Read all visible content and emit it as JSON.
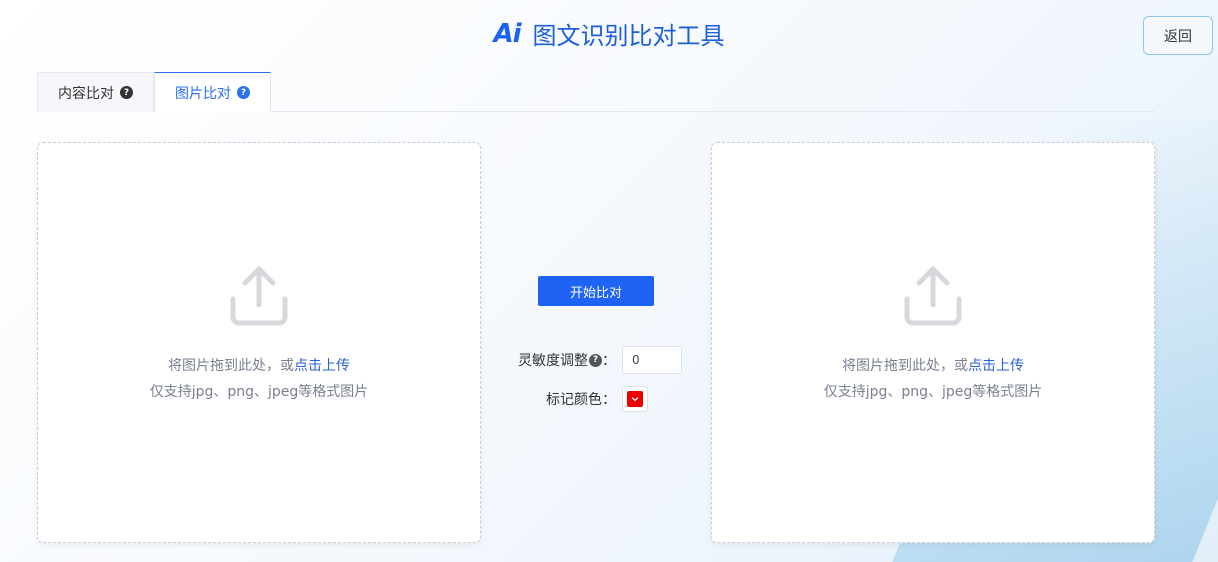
{
  "header": {
    "logo_text": "Ai",
    "title": "图文识别比对工具",
    "back_label": "返回"
  },
  "tabs": [
    {
      "label": "内容比对",
      "active": false
    },
    {
      "label": "图片比对",
      "active": true
    }
  ],
  "upload": {
    "prompt_prefix": "将图片拖到此处，或",
    "prompt_link": "点击上传",
    "hint": "仅支持jpg、png、jpeg等格式图片"
  },
  "controls": {
    "start_label": "开始比对",
    "sensitivity_label": "灵敏度调整",
    "sensitivity_value": "0",
    "mark_color_label": "标记颜色：",
    "mark_color": "#ee0000"
  },
  "colors": {
    "accent": "#1f63f5",
    "title": "#1d5fd8"
  },
  "icons": [
    "upload-icon",
    "question-icon",
    "chevron-down-icon"
  ]
}
